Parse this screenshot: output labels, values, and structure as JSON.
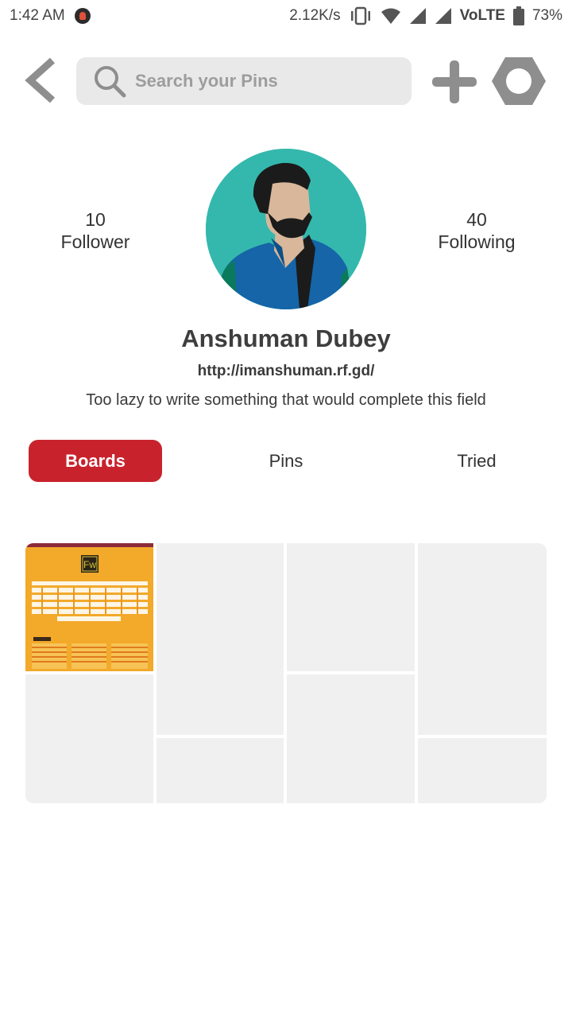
{
  "status_bar": {
    "time": "1:42 AM",
    "speed": "2.12K/s",
    "network": "VoLTE",
    "battery": "73%"
  },
  "toolbar": {
    "search_placeholder": "Search your Pins",
    "icons": [
      "back-icon",
      "search-icon",
      "plus-icon",
      "settings-hexagon-icon"
    ]
  },
  "profile": {
    "followers": {
      "count": "10",
      "label": "Follower"
    },
    "following": {
      "count": "40",
      "label": "Following"
    },
    "name": "Anshuman Dubey",
    "url": "http://imanshuman.rf.gd/",
    "bio": "Too lazy to write something that would complete this field"
  },
  "tabs": [
    {
      "label": "Boards",
      "active": true
    },
    {
      "label": "Pins",
      "active": false
    },
    {
      "label": "Tried",
      "active": false
    }
  ],
  "board": {
    "thumb_badge": "Fw"
  },
  "colors": {
    "accent": "#c8232c",
    "avatar_bg": "#34b8ad",
    "placeholder_tile": "#f0f0f0",
    "icon_gray": "#8e8e8e"
  }
}
